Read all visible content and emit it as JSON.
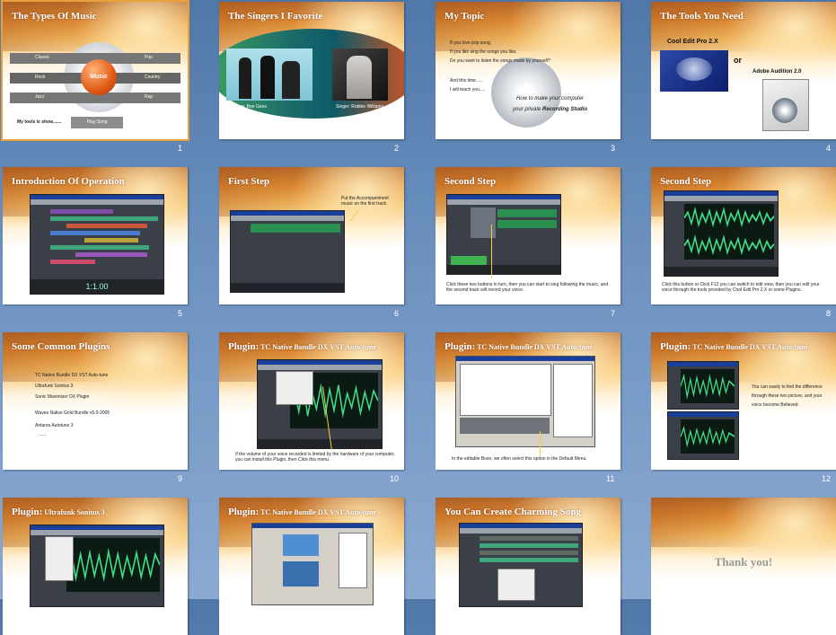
{
  "slides": [
    {
      "n": "1",
      "title": "The Types Of Music",
      "center": "Music",
      "labels": [
        "Classic",
        "Pop",
        "Rock",
        "Country",
        "Jazz",
        "Rap"
      ],
      "foot": "My tools is show.......",
      "button": "Play Song"
    },
    {
      "n": "2",
      "title": "The Singers I Favorite",
      "cap1": "Group: Bee Gees",
      "cap2": "Singer: Robbie Williams"
    },
    {
      "n": "3",
      "title": "My Topic",
      "lines": [
        "If you love pop song,",
        "If you like sing the songs you like,",
        "Do you want to listen the songs made by yourself?",
        "",
        "And this time.....",
        "I will teach you....."
      ],
      "tag1": "How to make your computer",
      "tag2a": "your private ",
      "tag2b": "Recording Studio"
    },
    {
      "n": "4",
      "title": "The Tools You Need",
      "tool1": "Cool Edit Pro 2.X",
      "or": "or",
      "tool2": "Adobe Audition 2.0"
    },
    {
      "n": "5",
      "title": "Introduction Of Operation",
      "time": "1:1.00"
    },
    {
      "n": "6",
      "title": "First Step",
      "note": "Put the Accompaniment music on the first track."
    },
    {
      "n": "7",
      "title": "Second Step",
      "note": "Click these two buttons in turn, then you can start to sing following the music, and the second track will record your voice."
    },
    {
      "n": "8",
      "title": "Second Step",
      "note": "Click this button or Click F12 you can switch to edit view, then you can edit your voice through the tools provided by Cool Edit Pro 2.X or some Plugins."
    },
    {
      "n": "9",
      "title": "Some Common Plugins",
      "items": [
        "TC Native Bundle DX VST Auto-tune",
        "Ultrafunk Sonitus 3",
        "Sonic Maximizer DX Plugin",
        "Waves Native Gold Bundle v5.0-2005",
        "Antares Autotune 3",
        "......"
      ]
    },
    {
      "n": "10",
      "title": "Plugin:",
      "sub": " TC Native Bundle DX VST Auto-tune",
      "note": "If the volume of your voice recorded is limited by the hardware of your computer, you can install this Plugin, then Click this menu."
    },
    {
      "n": "11",
      "title": "Plugin:",
      "sub": " TC Native Bundle DX VST Auto-tune",
      "note": "In the editable Boxe, we often select this option in the Default Menu."
    },
    {
      "n": "12",
      "title": "Plugin:",
      "sub": " TC Native Bundle DX VST Auto-tune",
      "note": "You can easily to find the difference through these two picture, and your voice become Believed."
    },
    {
      "n": "13",
      "title": "Plugin:",
      "sub": " Ultrafunk Sonitus 3"
    },
    {
      "n": "14",
      "title": "Plugin:",
      "sub": " TC Native Bundle DX VST Auto-tune"
    },
    {
      "n": "15",
      "title": "You Can Create Charming Song"
    },
    {
      "n": "16",
      "title": "",
      "thanks": "Thank you!"
    }
  ]
}
